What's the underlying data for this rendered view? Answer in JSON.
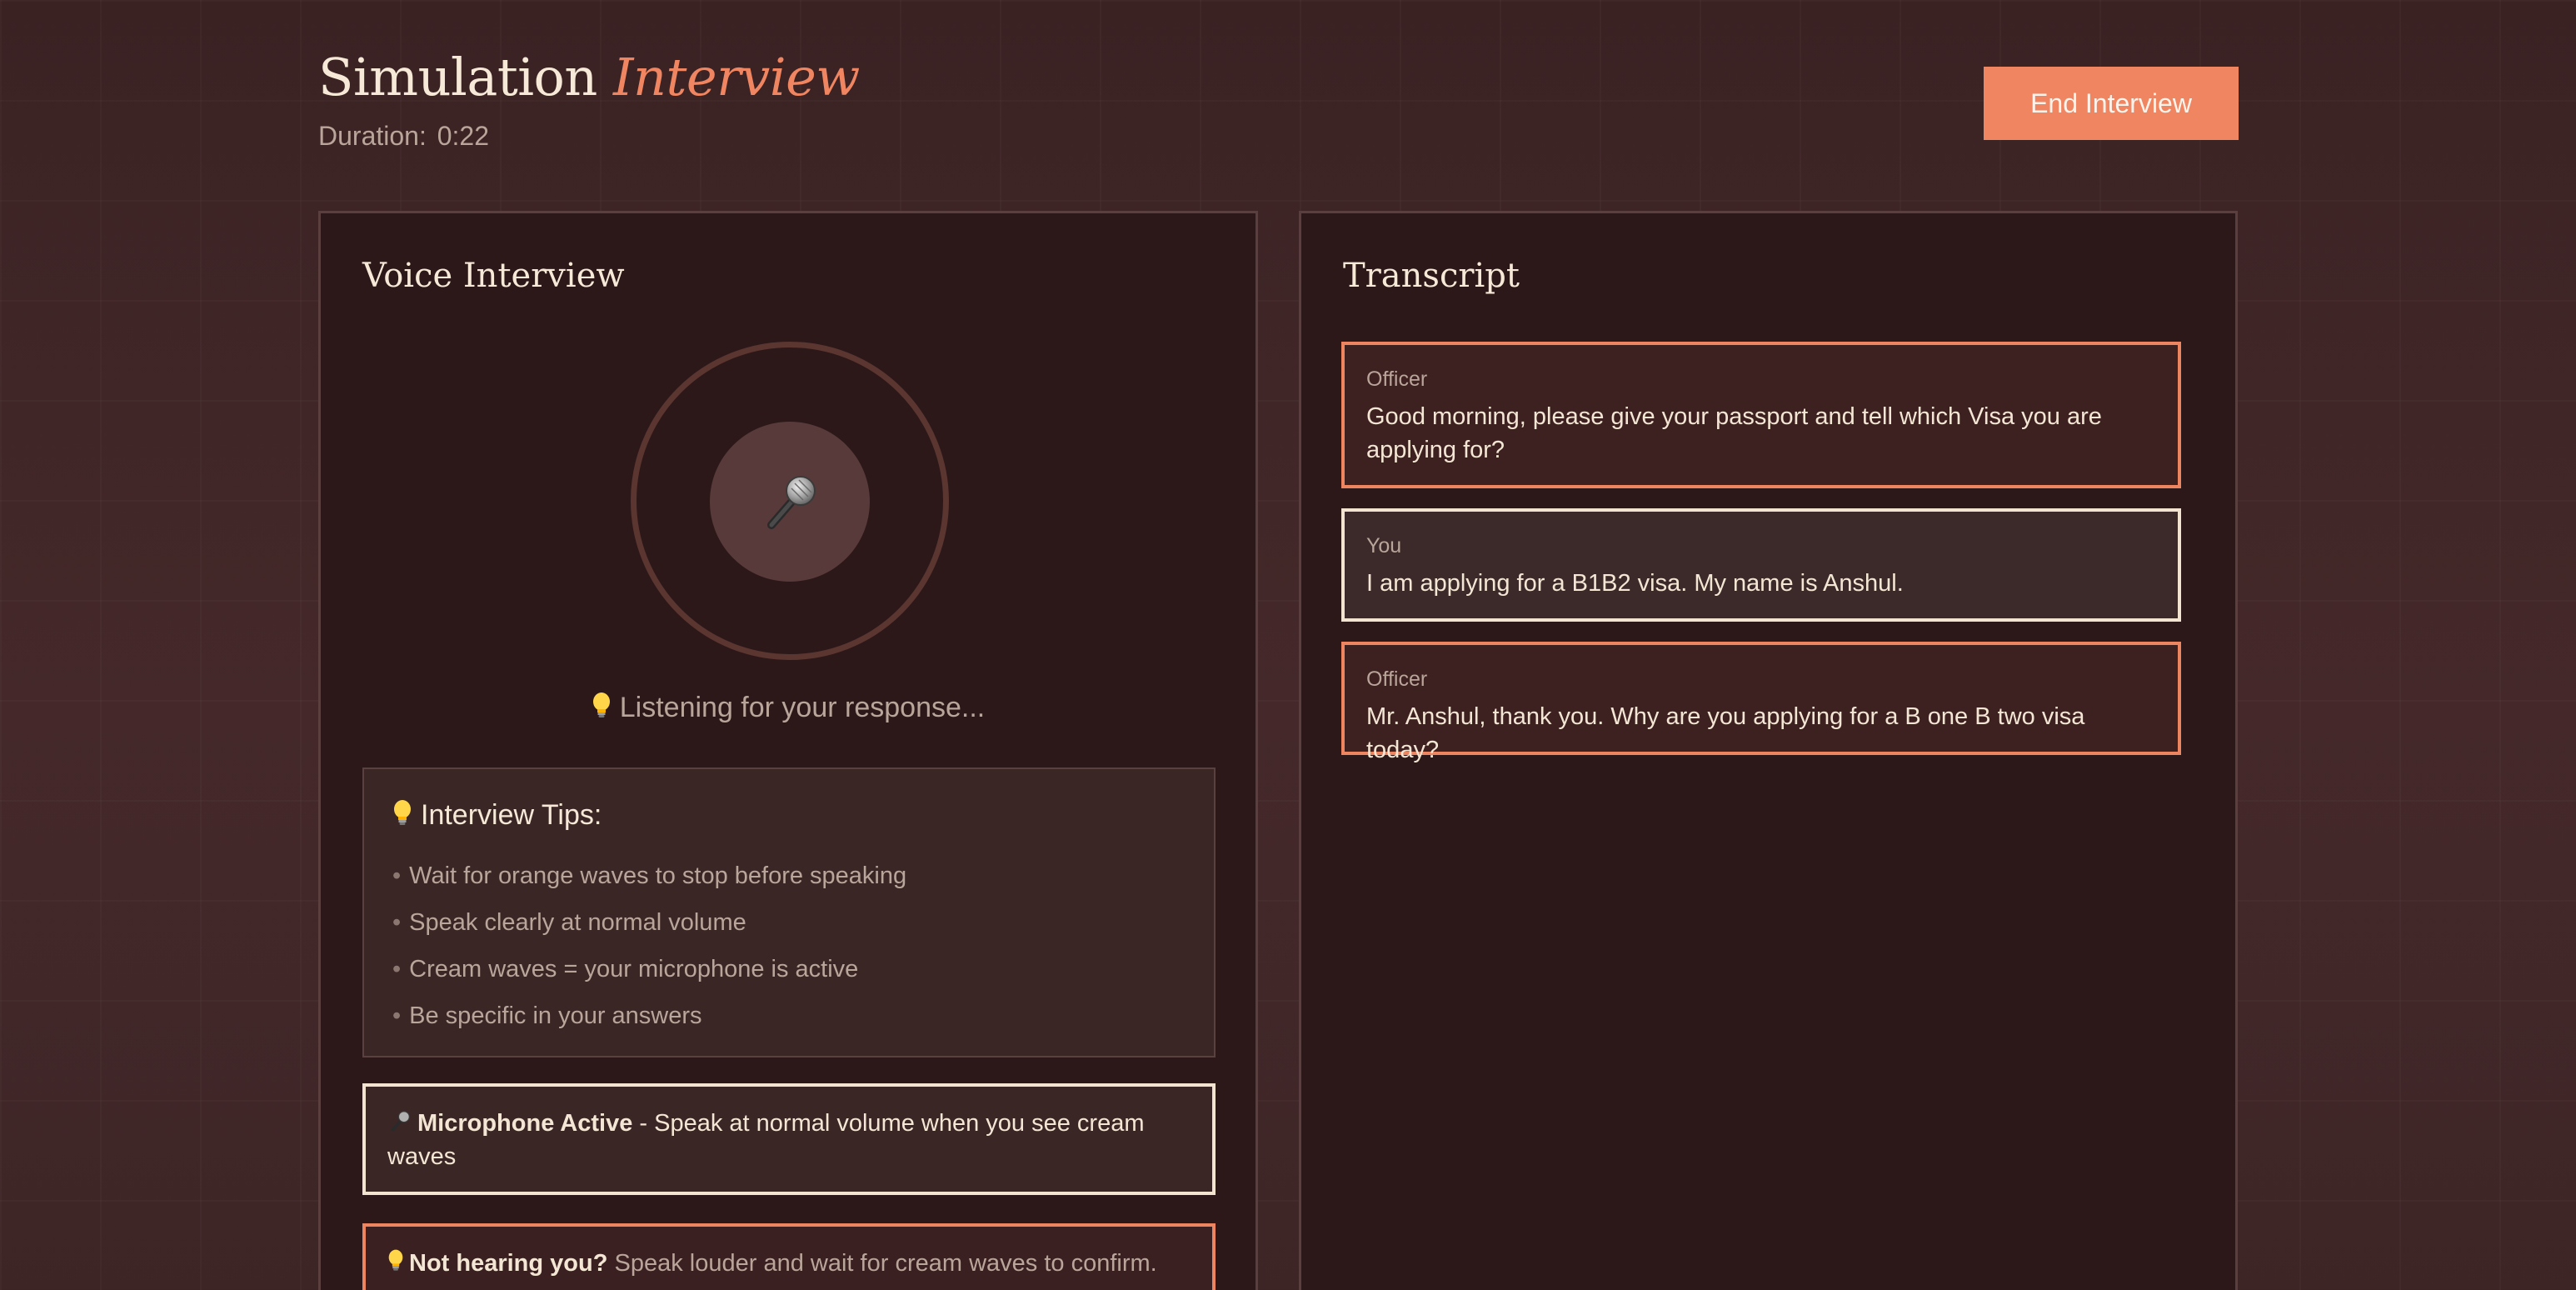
{
  "header": {
    "title_main": "Simulation",
    "title_accent": "Interview",
    "duration_label": "Duration:",
    "duration_value": "0:22",
    "end_button_label": "End Interview"
  },
  "voice_panel": {
    "title": "Voice Interview",
    "mic_icon": "microphone-icon",
    "status": "Listening for your response...",
    "status_icon": "lightbulb-icon",
    "tips": {
      "title": "Interview Tips:",
      "icon": "lightbulb-icon",
      "items": [
        "Wait for orange waves to stop before speaking",
        "Speak clearly at normal volume",
        "Cream waves = your microphone is active",
        "Be specific in your answers"
      ]
    },
    "mic_notice": {
      "icon": "microphone-icon",
      "title": "Microphone Active",
      "text": "- Speak at normal volume when you see cream waves"
    },
    "hearing_notice": {
      "icon": "lightbulb-icon",
      "title": "Not hearing you?",
      "text": "Speak louder and wait for cream waves to confirm."
    }
  },
  "transcript_panel": {
    "title": "Transcript",
    "messages": [
      {
        "speaker": "Officer",
        "text": "Good morning, please give your passport and tell which Visa you are applying for?"
      },
      {
        "speaker": "You",
        "text": "I am applying for a B1B2 visa. My name is Anshul."
      },
      {
        "speaker": "Officer",
        "text": "Mr. Anshul, thank you. Why are you applying for a B one B two visa today?"
      }
    ]
  },
  "colors": {
    "accent": "#ef8561",
    "cream": "#f3e4d1",
    "background": "#3a2324",
    "panel": "#2c1819"
  }
}
